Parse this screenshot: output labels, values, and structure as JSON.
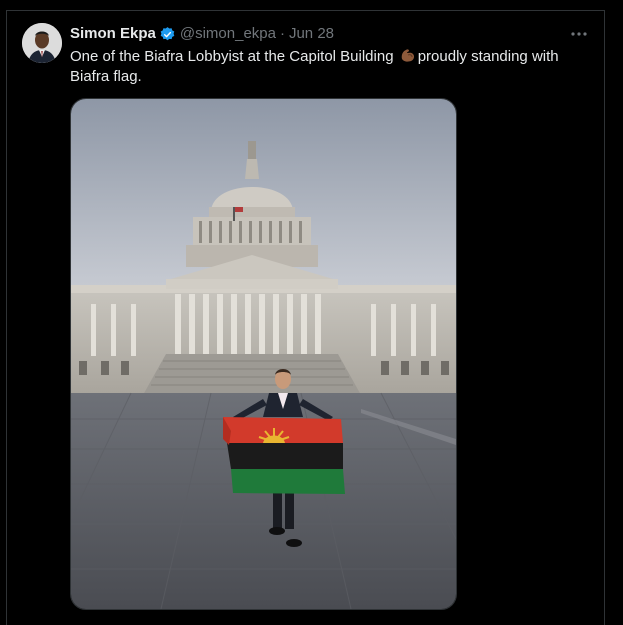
{
  "tweet": {
    "author_name": "Simon Ekpa",
    "handle": "@simon_ekpa",
    "separator": "·",
    "date": "Jun 28",
    "text_before_emoji": "One of the Biafra Lobbyist at the Capitol Building ",
    "text_after_emoji": "proudly standing with Biafra flag.",
    "emoji": "muscle-emoji",
    "icons": {
      "verified": "verified-badge-icon",
      "more": "more-options-icon"
    },
    "colors": {
      "verified": "#1d9bf0",
      "text": "#e7e9ea",
      "muted": "#71767b",
      "background": "#000000"
    }
  },
  "media": {
    "description_icon": "photo",
    "flag_colors": {
      "red": "#d23a2b",
      "black": "#1b1b1b",
      "green": "#1f7a3a",
      "sun": "#e9b531"
    }
  }
}
